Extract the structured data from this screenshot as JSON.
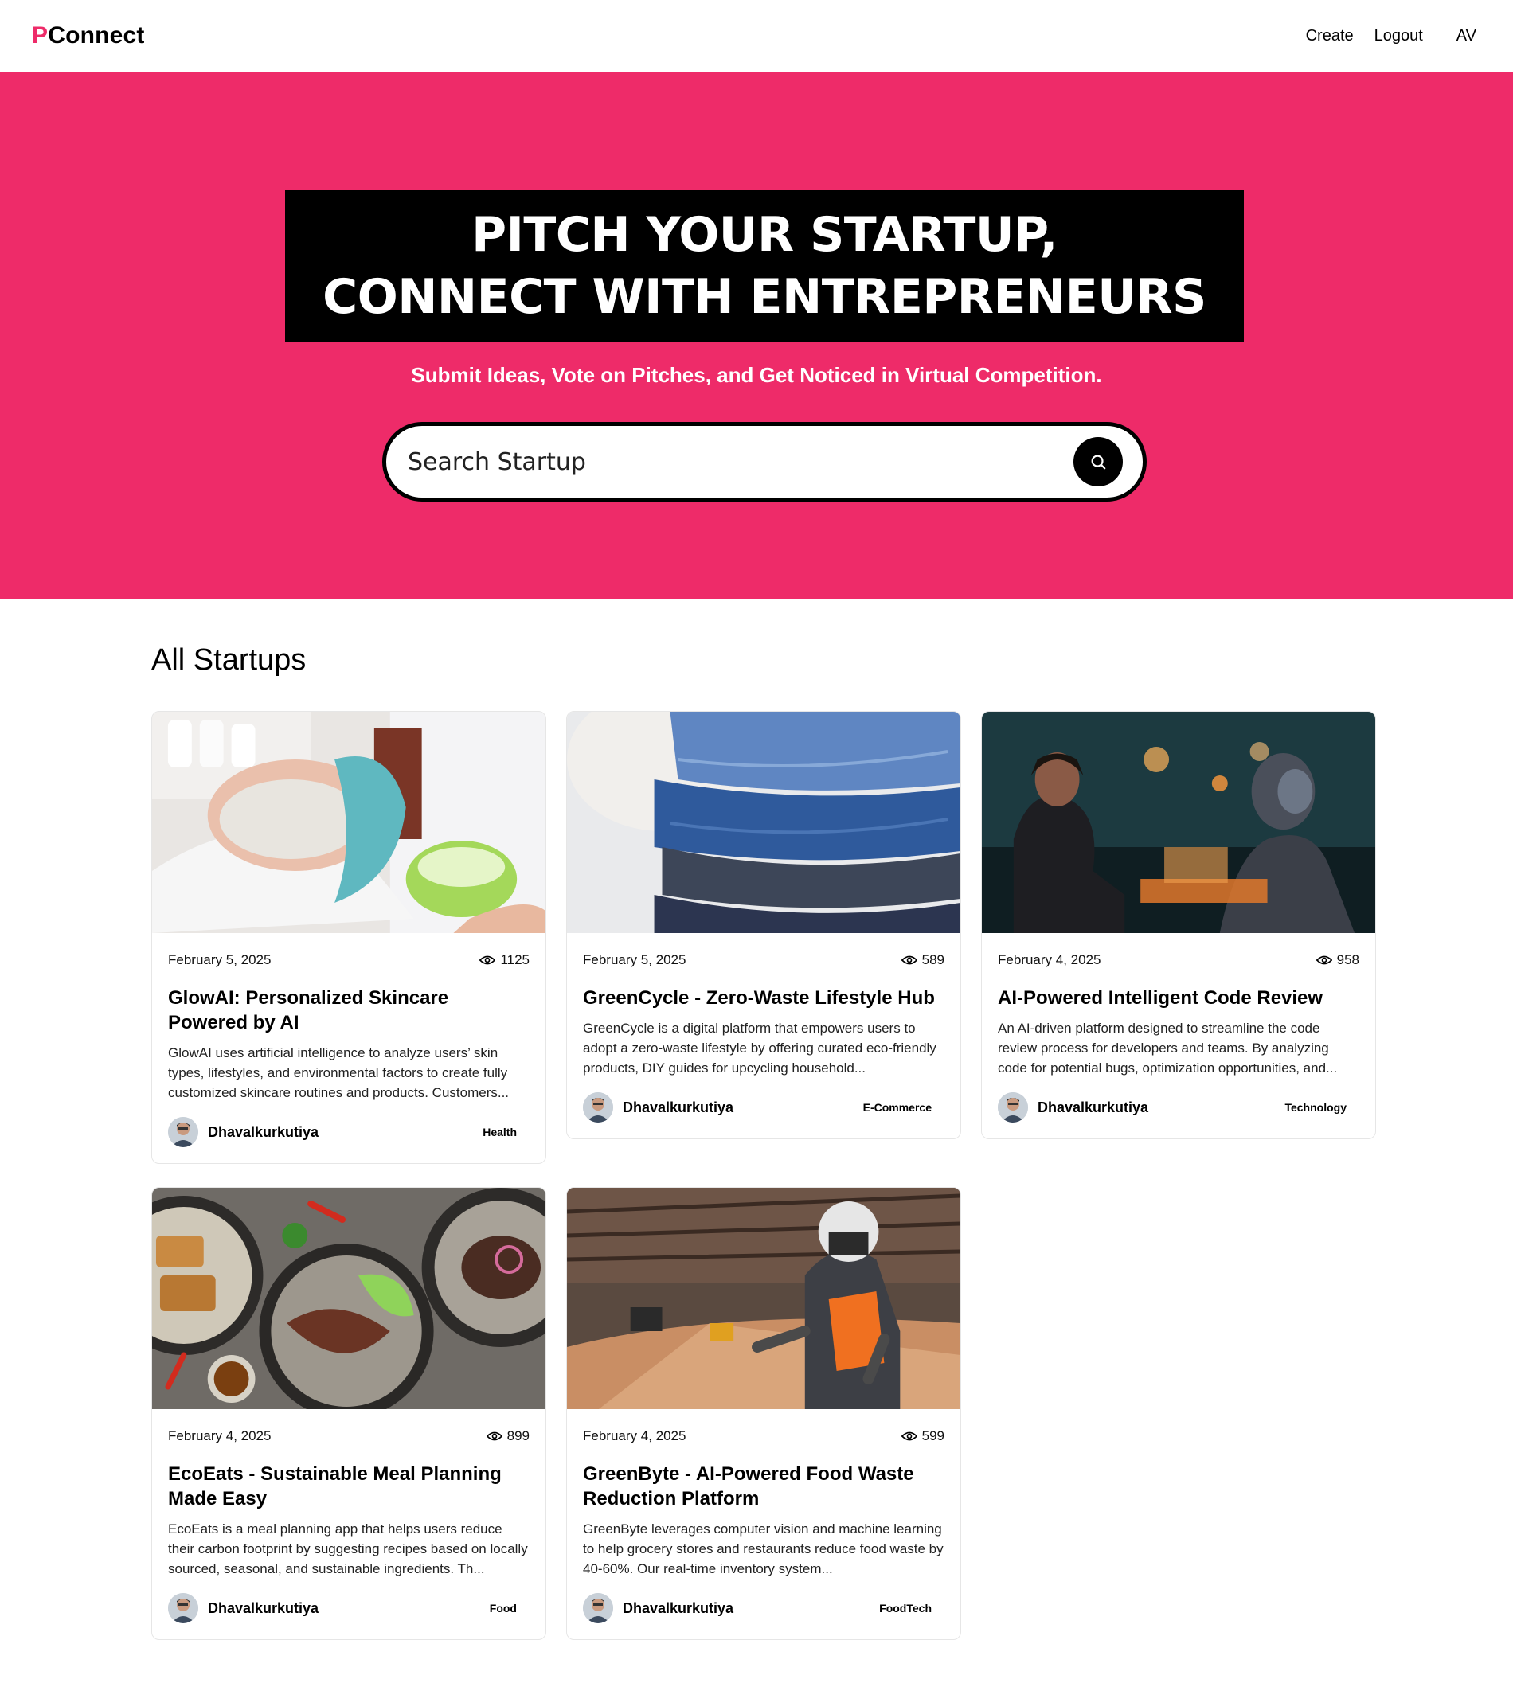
{
  "nav": {
    "logo_accent": "P",
    "logo_rest": "Connect",
    "create": "Create",
    "logout": "Logout",
    "avatar_text": "AV"
  },
  "hero": {
    "title_line1": "PITCH YOUR STARTUP,",
    "title_line2": "CONNECT WITH ENTREPRENEURS",
    "subtitle": "Submit Ideas, Vote on Pitches, and Get Noticed in Virtual Competition.",
    "search_placeholder": "Search Startup"
  },
  "section": {
    "title": "All Startups"
  },
  "colors": {
    "brand": "#ee2b69",
    "black": "#000000"
  },
  "cards": [
    {
      "date": "February 5, 2025",
      "views": "1125",
      "title": "GlowAI: Personalized Skincare Powered by AI",
      "description": "GlowAI uses artificial intelligence to analyze users’ skin types, lifestyles, and environmental factors to create fully customized skincare routines and products. Customers...",
      "author": "Dhavalkurkutiya",
      "category": "Health",
      "image_icon": "skincare-photo"
    },
    {
      "date": "February 5, 2025",
      "views": "589",
      "title": "GreenCycle - Zero-Waste Lifestyle Hub",
      "description": "GreenCycle is a digital platform that empowers users to adopt a zero-waste lifestyle by offering curated eco-friendly products, DIY guides for upcycling household...",
      "author": "Dhavalkurkutiya",
      "category": "E-Commerce",
      "image_icon": "denim-stack-photo"
    },
    {
      "date": "February 4, 2025",
      "views": "958",
      "title": "AI-Powered Intelligent Code Review",
      "description": "An AI-driven platform designed to streamline the code review process for developers and teams. By analyzing code for potential bugs, optimization opportunities, and...",
      "author": "Dhavalkurkutiya",
      "category": "Technology",
      "image_icon": "ai-robot-photo"
    },
    {
      "date": "February 4, 2025",
      "views": "899",
      "title": "EcoEats - Sustainable Meal Planning Made Easy",
      "description": "EcoEats is a meal planning app that helps users reduce their carbon footprint by suggesting recipes based on locally sourced, seasonal, and sustainable ingredients. Th...",
      "author": "Dhavalkurkutiya",
      "category": "Food",
      "image_icon": "food-plates-photo"
    },
    {
      "date": "February 4, 2025",
      "views": "599",
      "title": "GreenByte - AI-Powered Food Waste Reduction Platform",
      "description": "GreenByte leverages computer vision and machine learning to help grocery stores and restaurants reduce food waste by 40-60%. Our real-time inventory system...",
      "author": "Dhavalkurkutiya",
      "category": "FoodTech",
      "image_icon": "worker-workshop-photo"
    }
  ]
}
